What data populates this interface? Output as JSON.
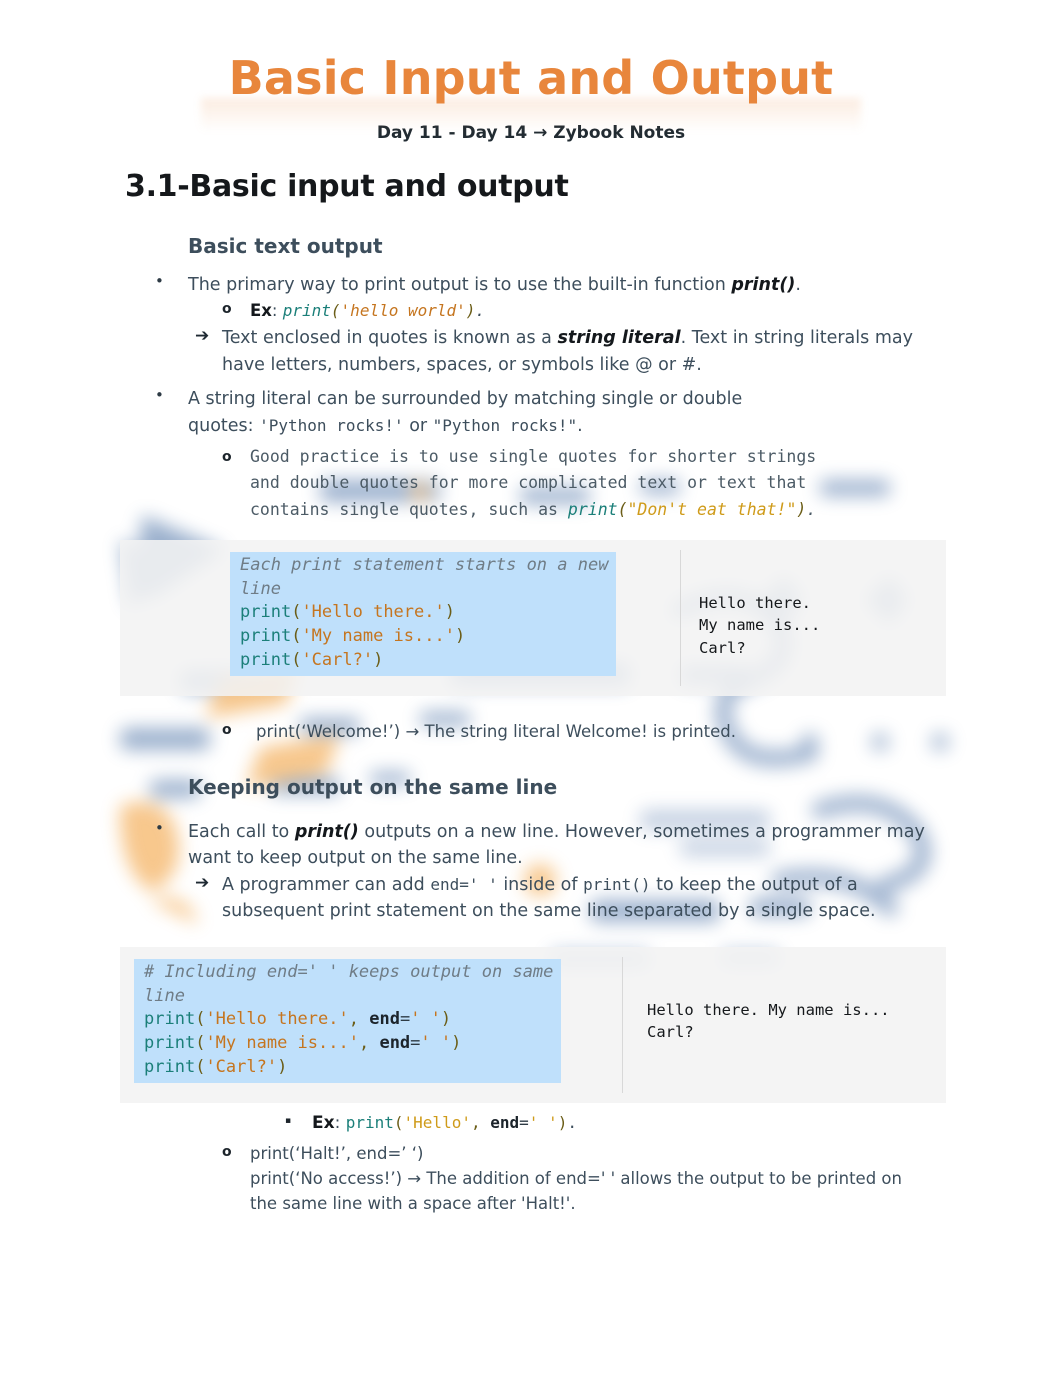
{
  "document": {
    "title": "Basic Input and Output",
    "subtitle_prefix": "Day 11 - Day 14 ",
    "subtitle_arrow": "→",
    "subtitle_suffix": " Zybook Notes",
    "section_heading": "3.1-Basic input and output",
    "accent_color": "#e8863c",
    "body_color": "#3d4e5c"
  },
  "markers": {
    "bullet_dot": "•",
    "bullet_o": "o",
    "bullet_arrow": "➔",
    "bullet_square": "▪"
  },
  "section1": {
    "heading": "Basic text output",
    "b1": {
      "text_before": "The primary way to print output is to use the built-in function ",
      "bold": "print()",
      "text_after": "."
    },
    "b1_sub": {
      "ex_label": "Ex",
      "colon": ": ",
      "fn": "print",
      "open": "(",
      "str": "'hello world'",
      "close": ")",
      "period": "."
    },
    "b1_arrow": {
      "text_before": " Text enclosed in quotes is known as a ",
      "bold": "string literal",
      "text_after": ". Text in string literals may have letters, numbers, spaces, or symbols like @ or #."
    },
    "b2": {
      "line1": "A string literal can be surrounded by matching single or double",
      "line2_prefix": "quotes: ",
      "code1": "'Python rocks!'",
      "mid": " or ",
      "code2": "\"Python rocks!\"",
      "period": "."
    },
    "b2_sub": {
      "line1": "Good practice is to use single quotes for shorter strings",
      "line2": "and double quotes for more complicated text or text that",
      "line3_prefix": "contains single quotes, such as ",
      "fn": "print",
      "open": "(",
      "str": "\"Don't eat that!\"",
      "close": ")",
      "period": "."
    },
    "welcome_line": {
      "code": "print(‘Welcome!’) ",
      "arrow": "→",
      "text": " The string literal Welcome! is printed."
    }
  },
  "code_block_1": {
    "comment_line1": "Each print statement starts on a new",
    "comment_line2": "line",
    "lines": [
      {
        "fn": "print",
        "open": "(",
        "str": "'Hello there.'",
        "close": ")"
      },
      {
        "fn": "print",
        "open": "(",
        "str": "'My name is...'",
        "close": ")"
      },
      {
        "fn": "print",
        "open": "(",
        "str": "'Carl?'",
        "close": ")"
      }
    ],
    "output": "Hello there.\nMy name is...\nCarl?"
  },
  "section2": {
    "heading": "Keeping output on the same line",
    "b1": {
      "text_before": "Each call to ",
      "bold": "print()",
      "text_after": " outputs on a new line. However, sometimes a programmer may want to keep output on the same line."
    },
    "b1_arrow": {
      "t1": "A programmer can add ",
      "code1": "end=' '",
      "t2": " inside of ",
      "code2": "print()",
      "t3": " to keep the output of a subsequent print statement on the same line separated by a single space."
    },
    "ex_line": {
      "ex_label": "Ex",
      "colon": ": ",
      "fn": "print",
      "open": "(",
      "str": "'Hello'",
      "comma": ", ",
      "kw": "end",
      "eq": "=",
      "str2": "' '",
      "close": ")",
      "period": "."
    },
    "halt_line": {
      "line1": "print(‘Halt!’, end=’ ‘)",
      "line2_prefix": "print(‘No access!’) ",
      "arrow": "→",
      "line2_rest": " The addition of end=' ' allows the output to be printed on the same line with a space after 'Halt!'."
    }
  },
  "code_block_2": {
    "comment_line1": "# Including end=' ' keeps output on same",
    "comment_line2": "line",
    "lines": [
      {
        "fn": "print",
        "open": "(",
        "str": "'Hello there.'",
        "comma": ", ",
        "kw": "end",
        "eq": "=",
        "str2": "' '",
        "close": ")"
      },
      {
        "fn": "print",
        "open": "(",
        "str": "'My name is...'",
        "comma": ", ",
        "kw": "end",
        "eq": "=",
        "str2": "' '",
        "close": ")"
      },
      {
        "fn": "print",
        "open": "(",
        "str": "'Carl?'",
        "close": ")"
      }
    ],
    "output": "Hello there. My name is...\nCarl?"
  }
}
